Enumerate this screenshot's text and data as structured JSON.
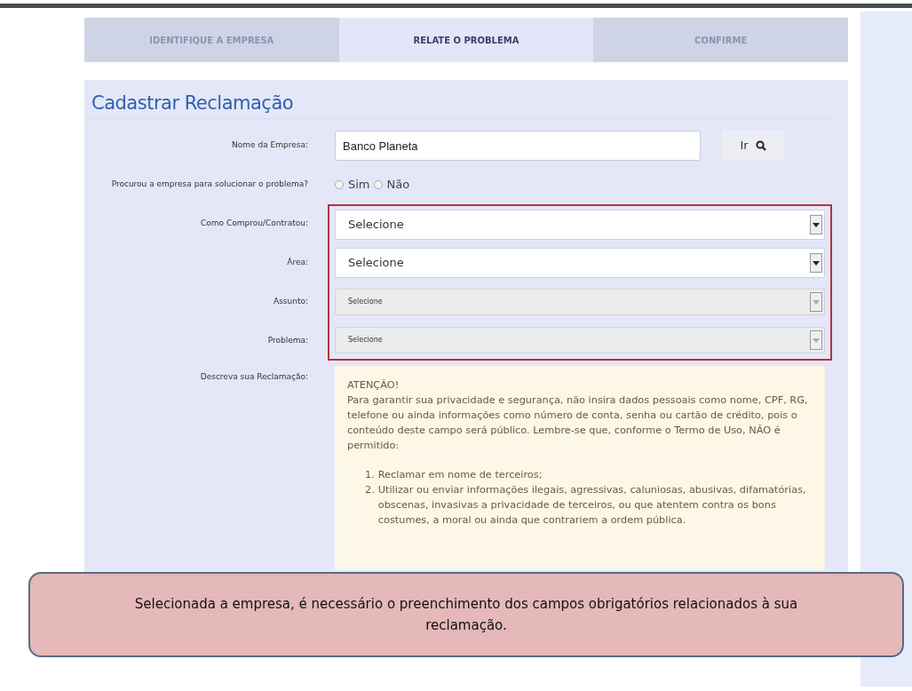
{
  "steps": [
    {
      "label": "IDENTIFIQUE A EMPRESA",
      "selected": false
    },
    {
      "label": "RELATE O PROBLEMA",
      "selected": true
    },
    {
      "label": "CONFIRME",
      "selected": false
    }
  ],
  "form": {
    "title": "Cadastrar Reclamação",
    "rows": [
      {
        "kind": "text",
        "label": "Nome da Empresa:",
        "value": "Banco Planeta",
        "button": "Ir",
        "highlighted": false
      },
      {
        "kind": "radio",
        "label": "Procurou a empresa para solucionar o problema?",
        "options": [
          {
            "label": "Sim",
            "selected": false
          },
          {
            "label": "Não",
            "selected": false
          }
        ],
        "highlighted": false
      },
      {
        "kind": "select",
        "label": "Como Comprou/Contratou:",
        "value": "Selecione",
        "disabled": false,
        "highlighted": true
      },
      {
        "kind": "select",
        "label": "Área:",
        "value": "Selecione",
        "disabled": false,
        "highlighted": true
      },
      {
        "kind": "select",
        "label": "Assunto:",
        "value": "Selecione",
        "disabled": true,
        "highlighted": true
      },
      {
        "kind": "select",
        "label": "Problema:",
        "value": "Selecione",
        "disabled": true,
        "highlighted": true
      },
      {
        "kind": "notice",
        "label": "Descreva sua Reclamação:",
        "heading": "ATENÇÃO!",
        "text": "Para garantir sua privacidade e segurança, não insira dados pessoais como nome, CPF, RG, telefone ou ainda informações como número de conta, senha ou cartão de crédito, pois o conteúdo deste campo será público. Lembre-se que, conforme o Termo de Uso, NÃO é permitido:",
        "items": [
          {
            "marker": "1.",
            "text": "Reclamar em nome de terceiros;"
          },
          {
            "marker": "2.",
            "text": "Utilizar ou enviar informações ilegais, agressivas, caluniosas, abusivas, difamatórias, obscenas, invasivas a privacidade de terceiros, ou que atentem contra os bons costumes, a moral ou ainda que contrariem a ordem pública."
          }
        ],
        "highlighted": false
      }
    ]
  },
  "callout": {
    "text": "Selecionada a empresa, é necessário o preenchimento dos campos obrigatórios relacionados à sua reclamação."
  }
}
